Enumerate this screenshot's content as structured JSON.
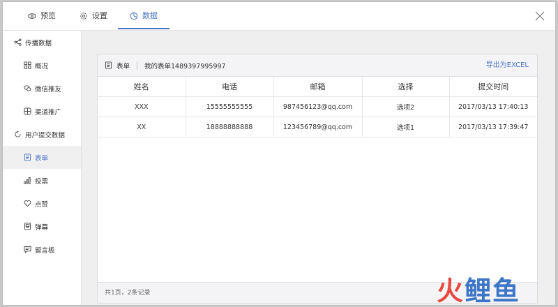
{
  "tabs": [
    {
      "label": "预览",
      "icon": "eye-icon",
      "active": false
    },
    {
      "label": "设置",
      "icon": "gear-icon",
      "active": false
    },
    {
      "label": "数据",
      "icon": "pie-chart-icon",
      "active": true
    }
  ],
  "accent_color": "#4a76c9",
  "sidebar": {
    "groups": [
      {
        "label": "传播数据",
        "icon": "share-icon",
        "items": [
          {
            "label": "概况",
            "icon": "grid-icon"
          },
          {
            "label": "微信推友",
            "icon": "wechat-icon"
          },
          {
            "label": "渠道推广",
            "icon": "channel-icon"
          }
        ]
      },
      {
        "label": "用户提交数据",
        "icon": "refresh-icon",
        "items": [
          {
            "label": "表单",
            "icon": "form-icon",
            "active": true
          },
          {
            "label": "投票",
            "icon": "vote-bars-icon"
          },
          {
            "label": "点赞",
            "icon": "heart-icon"
          },
          {
            "label": "弹幕",
            "icon": "danmaku-icon"
          },
          {
            "label": "留言板",
            "icon": "message-icon"
          }
        ]
      }
    ]
  },
  "panel": {
    "type_label": "表单",
    "form_name": "我的表单1489397995997",
    "export_label": "导出为EXCEL",
    "columns": [
      "姓名",
      "电话",
      "邮箱",
      "选择",
      "提交时间"
    ],
    "rows": [
      [
        "XXX",
        "15555555555",
        "987456123@qq.com",
        "选项2",
        "2017/03/13 17:40:13"
      ],
      [
        "XX",
        "18888888888",
        "123456789@qq.com",
        "选项1",
        "2017/03/13 17:39:47"
      ]
    ],
    "footer": "共1页，2条记录"
  },
  "watermark": [
    "火",
    "鲤",
    "鱼"
  ]
}
